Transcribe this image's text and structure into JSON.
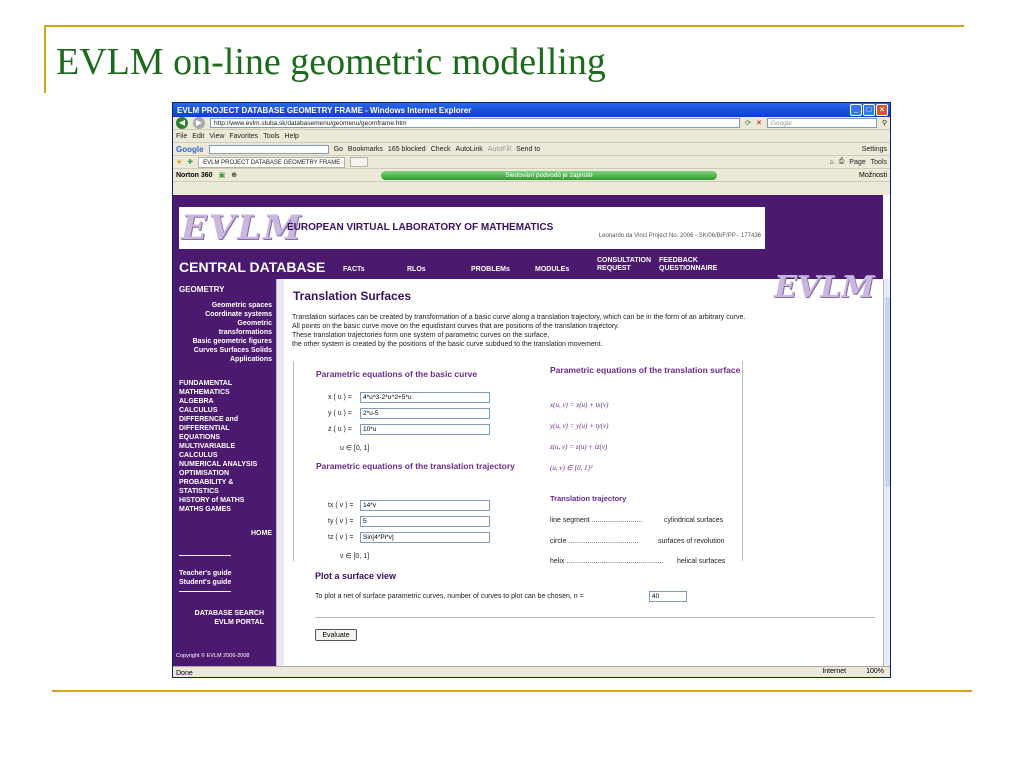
{
  "slide": {
    "title": "EVLM on-line geometric modelling"
  },
  "browser": {
    "window_title": "EVLM PROJECT DATABASE GEOMETRY FRAME - Windows Internet Explorer",
    "url": "http://www.evlm.stuba.sk/databasemenu/geomenu/geomframe.htm",
    "search_placeholder": "Google",
    "menu": [
      "File",
      "Edit",
      "View",
      "Favorites",
      "Tools",
      "Help"
    ],
    "google_toolbar": [
      "Google",
      "Go",
      "Bookmarks",
      "165 blocked",
      "Check",
      "AutoLink",
      "AutoFill",
      "Send to",
      "Settings"
    ],
    "tab_label": "EVLM PROJECT DATABASE GEOMETRY FRAME",
    "tab_tools": [
      "Page",
      "Tools"
    ],
    "norton": "Norton 360",
    "norton_status": "Sledování podvodů je zapnuté",
    "norton_options": "Možnosti",
    "status_left": "Done",
    "status_zone": "Internet",
    "zoom": "100%"
  },
  "site": {
    "logo": "EVLM",
    "banner_title": "EUROPEAN VIRTUAL LABORATORY OF MATHEMATICS",
    "banner_sub": "Leonardo da Vinci Project No. 2006 - SK/06/B/F/PP - 177436",
    "central": "CENTRAL DATABASE",
    "nav": [
      "FACTs",
      "RLOs",
      "PROBLEMs",
      "MODULEs",
      "CONSULTATION REQUEST",
      "FEEDBACK QUESTIONNAIRE"
    ]
  },
  "sidebar": {
    "title": "GEOMETRY",
    "sub_items": [
      "Geometric spaces",
      "Coordinate systems",
      "Geometric transformations",
      "Basic geometric figures",
      "Curves Surfaces Solids",
      "Applications"
    ],
    "items": [
      "FUNDAMENTAL MATHEMATICS",
      "ALGEBRA",
      "CALCULUS",
      "DIFFERENCE and DIFFERENTIAL EQUATIONS",
      "MULTIVARIABLE CALCULUS",
      "NUMERICAL ANALYSIS",
      "OPTIMISATION",
      "PROBABILITY & STATISTICS",
      "HISTORY of MATHS",
      "MATHS GAMES"
    ],
    "home": "HOME",
    "guides": [
      "Teacher's guide",
      "Student's guide"
    ],
    "bottom": [
      "DATABASE SEARCH",
      "EVLM PORTAL"
    ],
    "copyright": "Copyright © EVLM 2006-2008"
  },
  "main": {
    "heading": "Translation Surfaces",
    "paragraph": [
      "Translation surfaces can be created by transformation of a basic curve along a translation trajectory, which can be in the form of an arbitrary curve.",
      "All points on the basic curve move on the equidistant curves that are positions of the translation trajectory.",
      "These translation trajectories form one system of parametric curves on the surface,",
      "the other system is created by the positions of the basic curve subdued to the translation movement."
    ],
    "basic_curve_title": "Parametric equations of the basic curve",
    "x_label": "x ( u ) =",
    "x_value": "4*u^3-2*u^2+5*u",
    "y_label": "y ( u ) =",
    "y_value": "2*u-5",
    "z_label": "z ( u ) =",
    "z_value": "10*u",
    "u_range": "u ∈ [0, 1]",
    "traj_title": "Parametric equations of the translation trajectory",
    "tx_label": "tx ( v ) =",
    "tx_value": "14*v",
    "ty_label": "ty ( v ) =",
    "ty_value": "5",
    "tz_label": "tz ( v ) =",
    "tz_value": "Sin[4*Pi*v]",
    "v_range": "v ∈ [0, 1]",
    "surface_title": "Parametric equations of the translation surface",
    "surf_x": "x(u, v) = x(u) + tx(v)",
    "surf_y": "y(u, v) = y(u) + ty(v)",
    "surf_z": "z(u, v) = z(u) + tz(v)",
    "surf_domain": "(u, v) ∈ [0, 1]²",
    "traj_heading": "Translation trajectory",
    "traj_rows": [
      {
        "left": "line segment ..........................",
        "right": "cylindrical surfaces"
      },
      {
        "left": "circle ....................................",
        "right": "surfaces of revolution"
      },
      {
        "left": "helix ..................................................",
        "right": "helical surfaces"
      }
    ],
    "plot_title": "Plot a surface view",
    "plot_text": "To plot a net of surface parametric curves, number of curves to plot can be chosen, n =",
    "n_value": "40",
    "evaluate": "Evaluate"
  }
}
